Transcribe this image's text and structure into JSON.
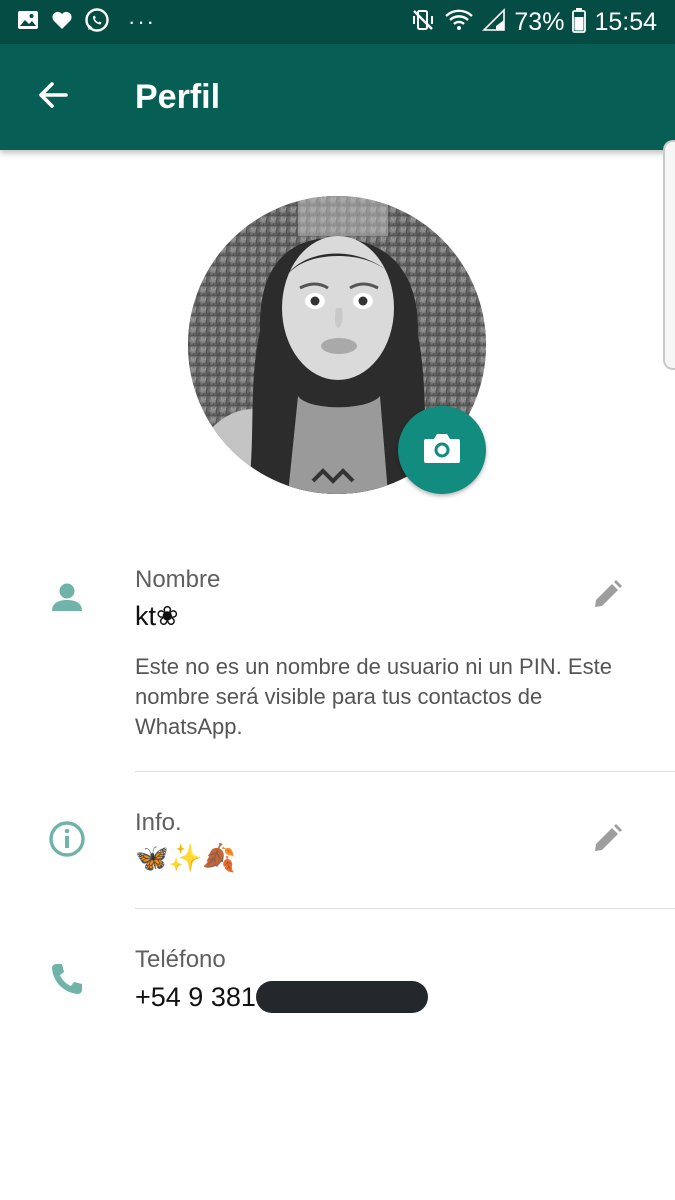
{
  "status_bar": {
    "icons": [
      "image-icon",
      "heart-icon",
      "whatsapp-icon",
      "more-dots-icon",
      "mute-vibrate-icon",
      "wifi-icon",
      "signal-icon",
      "battery-icon"
    ],
    "dots": "···",
    "battery": "73%",
    "time": "15:54"
  },
  "app_bar": {
    "back_icon": "arrow-left-icon",
    "title": "Perfil"
  },
  "avatar": {
    "camera_icon": "camera-icon"
  },
  "name_section": {
    "icon": "person-icon",
    "label": "Nombre",
    "value": "kt❀",
    "helper": "Este no es un nombre de usuario ni un PIN. Este nombre será visible para tus contactos de WhatsApp.",
    "edit_icon": "pencil-icon"
  },
  "info_section": {
    "icon": "info-icon",
    "label": "Info.",
    "value": "🦋✨🍂",
    "edit_icon": "pencil-icon"
  },
  "phone_section": {
    "icon": "phone-icon",
    "label": "Teléfono",
    "value_visible": "+54 9 381"
  },
  "colors": {
    "status_bar": "#054d44",
    "app_bar": "#075e54",
    "accent": "#128c7e",
    "icon_teal": "#6fb3a9"
  }
}
